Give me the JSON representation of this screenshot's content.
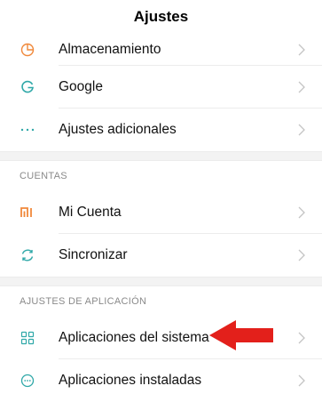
{
  "header": {
    "title": "Ajustes"
  },
  "group1": [
    {
      "label": "Almacenamiento",
      "icon": "storage-pie-icon"
    },
    {
      "label": "Google",
      "icon": "google-g-icon"
    },
    {
      "label": "Ajustes adicionales",
      "icon": "more-dots-icon"
    }
  ],
  "section_cuentas": {
    "title": "CUENTAS",
    "items": [
      {
        "label": "Mi Cuenta",
        "icon": "mi-logo-icon"
      },
      {
        "label": "Sincronizar",
        "icon": "sync-icon"
      }
    ]
  },
  "section_apps": {
    "title": "AJUSTES DE APLICACIÓN",
    "items": [
      {
        "label": "Aplicaciones del sistema",
        "icon": "grid-apps-icon"
      },
      {
        "label": "Aplicaciones instaladas",
        "icon": "installed-apps-icon"
      }
    ]
  },
  "colors": {
    "orange": "#f0883a",
    "teal": "#2fa8a8",
    "red_arrow": "#e3201b",
    "chevron": "#c4c4c4"
  }
}
